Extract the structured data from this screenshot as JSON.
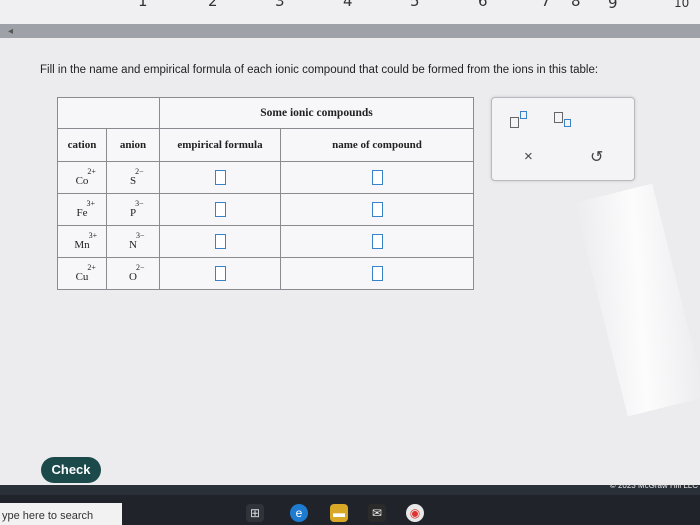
{
  "top_keys": [
    "1",
    "2",
    "3",
    "4",
    "5",
    "6",
    "7",
    "8",
    "9",
    "10"
  ],
  "instruction": "Fill in the name and empirical formula of each ionic compound that could be formed from the ions in this table:",
  "table": {
    "caption": "Some ionic compounds",
    "headers": [
      "cation",
      "anion",
      "empirical formula",
      "name of compound"
    ],
    "rows": [
      {
        "cation": "Co",
        "cation_charge": "2+",
        "anion": "S",
        "anion_charge": "2−",
        "empirical_formula": "",
        "name": ""
      },
      {
        "cation": "Fe",
        "cation_charge": "3+",
        "anion": "P",
        "anion_charge": "3−",
        "empirical_formula": "",
        "name": ""
      },
      {
        "cation": "Mn",
        "cation_charge": "3+",
        "anion": "N",
        "anion_charge": "3−",
        "empirical_formula": "",
        "name": ""
      },
      {
        "cation": "Cu",
        "cation_charge": "2+",
        "anion": "O",
        "anion_charge": "2−",
        "empirical_formula": "",
        "name": ""
      }
    ]
  },
  "palette": {
    "close_symbol": "×",
    "undo_symbol": "↺"
  },
  "check_button": "Check",
  "copyright": "© 2023 McGraw Hill LLC",
  "taskbar": {
    "search_placeholder": "ype here to search"
  },
  "colors": {
    "input_border": "#3a82c8",
    "check_bg": "#1c4a4a"
  }
}
